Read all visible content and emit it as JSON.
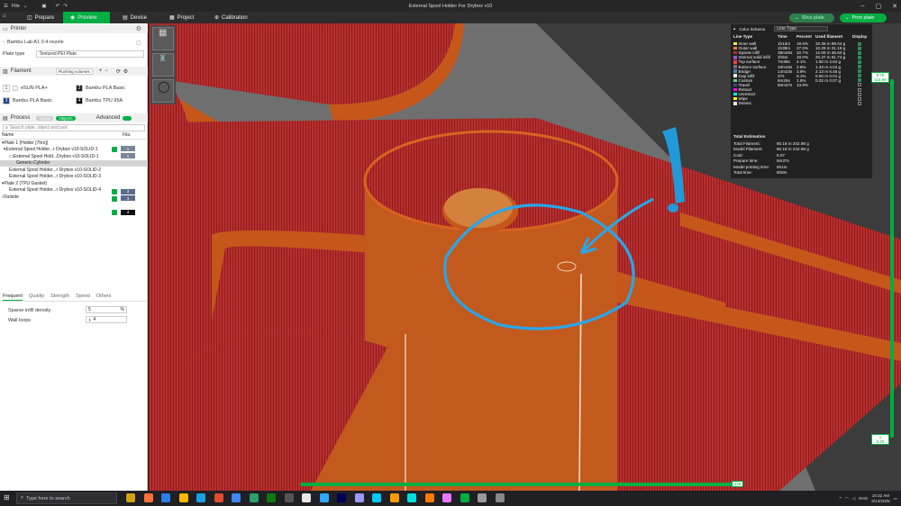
{
  "window": {
    "title": "External Spool Holder For Drybox v10",
    "menu": "File"
  },
  "nav": {
    "tabs": [
      "Prepare",
      "Preview",
      "Device",
      "Project",
      "Calibration"
    ],
    "active": "Preview",
    "slice_label": "Slice plate",
    "print_label": "Print plate"
  },
  "printer": {
    "header": "Printer",
    "name": "Bambu Lab A1 0.4 nozzle",
    "plate_type_label": "Plate type",
    "plate_type": "Textured PEI Plate"
  },
  "filament": {
    "header": "Filament",
    "flushing_label": "Flushing volumes",
    "slots": [
      {
        "num": "1",
        "name": "eSUN PLA+",
        "color": "#f2f2f2"
      },
      {
        "num": "2",
        "name": "Bambu PLA Basic",
        "color": "#222222"
      },
      {
        "num": "3",
        "name": "Bambu PLA Basic",
        "color": "#1d3f8f"
      },
      {
        "num": "4",
        "name": "Bambu TPU 95A",
        "color": "#111111"
      }
    ]
  },
  "process": {
    "header": "Process",
    "global_label": "Global",
    "objects_label": "Objects",
    "advanced_label": "Advanced",
    "search_placeholder": "Search plate, object and part"
  },
  "tree": {
    "col_name": "Name",
    "col_fila": "Fila.",
    "items": [
      {
        "label": "Plate 1 (Holder [7hrs])",
        "fila": "",
        "color": ""
      },
      {
        "label": "External Spool Holder...r Drybox v10-SOLID-1",
        "fila": "1",
        "color": "#7a869a"
      },
      {
        "label": "External Spool Hold...Drybox v10-SOLID-1",
        "fila": "1",
        "color": "#7a869a"
      },
      {
        "label": "Generic-Cylinder",
        "fila": "",
        "color": ""
      },
      {
        "label": "External Spool Holder...r Drybox v10-SOLID-2",
        "fila": "3",
        "color": "#5b6b8c"
      },
      {
        "label": "External Spool Holder...r Drybox v10-SOLID-3",
        "fila": "3",
        "color": "#5b6b8c"
      },
      {
        "label": "Plate 2 (TPU Gasket)",
        "fila": "",
        "color": ""
      },
      {
        "label": "External Spool Holder...r Drybox v10-SOLID-4",
        "fila": "4",
        "color": "#111111"
      },
      {
        "label": "Outside",
        "fila": "",
        "color": ""
      }
    ]
  },
  "settings": {
    "tabs": [
      "Frequent",
      "Quality",
      "Strength",
      "Speed",
      "Others"
    ],
    "sparse_label": "Sparse infill density",
    "sparse_value": "5",
    "sparse_unit": "%",
    "wall_label": "Wall loops",
    "wall_value": "4"
  },
  "legend": {
    "title": "Color Scheme",
    "scheme": "Line Type",
    "columns": [
      "Line Type",
      "Time",
      "Percent",
      "Used filament",
      "Display"
    ],
    "rows": [
      {
        "name": "Inner wall",
        "color": "#ffe640",
        "time": "1h13m",
        "pct": "19.6%",
        "used": "32.35 m  98.04 g",
        "on": true
      },
      {
        "name": "Outer wall",
        "color": "#ff7d38",
        "time": "1h39m",
        "pct": "27.0%",
        "used": "10.29 m  31.19 g",
        "on": true
      },
      {
        "name": "Sparse infill",
        "color": "#b03029",
        "time": "39m25s",
        "pct": "10.7%",
        "used": "12.08 m  36.60 g",
        "on": true
      },
      {
        "name": "Internal solid infill",
        "color": "#9654cc",
        "time": "1h6m",
        "pct": "18.0%",
        "used": "20.37 m  61.74 g",
        "on": true
      },
      {
        "name": "Top surface",
        "color": "#f04040",
        "time": "7m36s",
        "pct": "2.1%",
        "used": "1.60 m  4.84 g",
        "on": true
      },
      {
        "name": "Bottom surface",
        "color": "#7d6b7d",
        "time": "10m16s",
        "pct": "2.8%",
        "used": "1.33 m  4.04 g",
        "on": true
      },
      {
        "name": "Bridge",
        "color": "#4d80ba",
        "time": "14m23s",
        "pct": "3.9%",
        "used": "2.13 m  6.45 g",
        "on": true
      },
      {
        "name": "Gap infill",
        "color": "#ffffff",
        "time": "27s",
        "pct": "0.1%",
        "used": "0.00 m  0.01 g",
        "on": true
      },
      {
        "name": "Custom",
        "color": "#5ed194",
        "time": "6m26s",
        "pct": "1.8%",
        "used": "0.02 m  0.07 g",
        "on": true
      },
      {
        "name": "Travel",
        "color": "#38489c",
        "time": "50m47s",
        "pct": "13.8%",
        "used": "",
        "on": false
      },
      {
        "name": "Retract",
        "color": "#ff00ff",
        "time": "",
        "pct": "",
        "used": "",
        "on": false
      },
      {
        "name": "Unretract",
        "color": "#00ffff",
        "time": "",
        "pct": "",
        "used": "",
        "on": false
      },
      {
        "name": "Wipe",
        "color": "#ffff00",
        "time": "",
        "pct": "",
        "used": "",
        "on": false
      },
      {
        "name": "Seams",
        "color": "#e6e6e6",
        "time": "",
        "pct": "",
        "used": "",
        "on": false
      }
    ],
    "estimation_title": "Total Estimation",
    "estimation": [
      {
        "label": "Total Filament:",
        "value": "80.18 m    242.98 g"
      },
      {
        "label": "Model Filament:",
        "value": "80.18 m    242.98 g"
      },
      {
        "label": "Cost:",
        "value": "6.07"
      },
      {
        "label": "Prepare time:",
        "value": "6m37s"
      },
      {
        "label": "Model printing time:",
        "value": "6h1m"
      },
      {
        "label": "Total time:",
        "value": "6h8m"
      }
    ]
  },
  "sliders": {
    "top_layer": "9.76",
    "top_index": "115.98",
    "bottom_layer": "1",
    "bottom_index": "0.20",
    "h_value": "325"
  },
  "annotation": {
    "mark": "!"
  },
  "taskbar": {
    "search_placeholder": "Type here to search",
    "time": "10:32 AM",
    "date": "3/14/2025",
    "lang": "ENG"
  }
}
